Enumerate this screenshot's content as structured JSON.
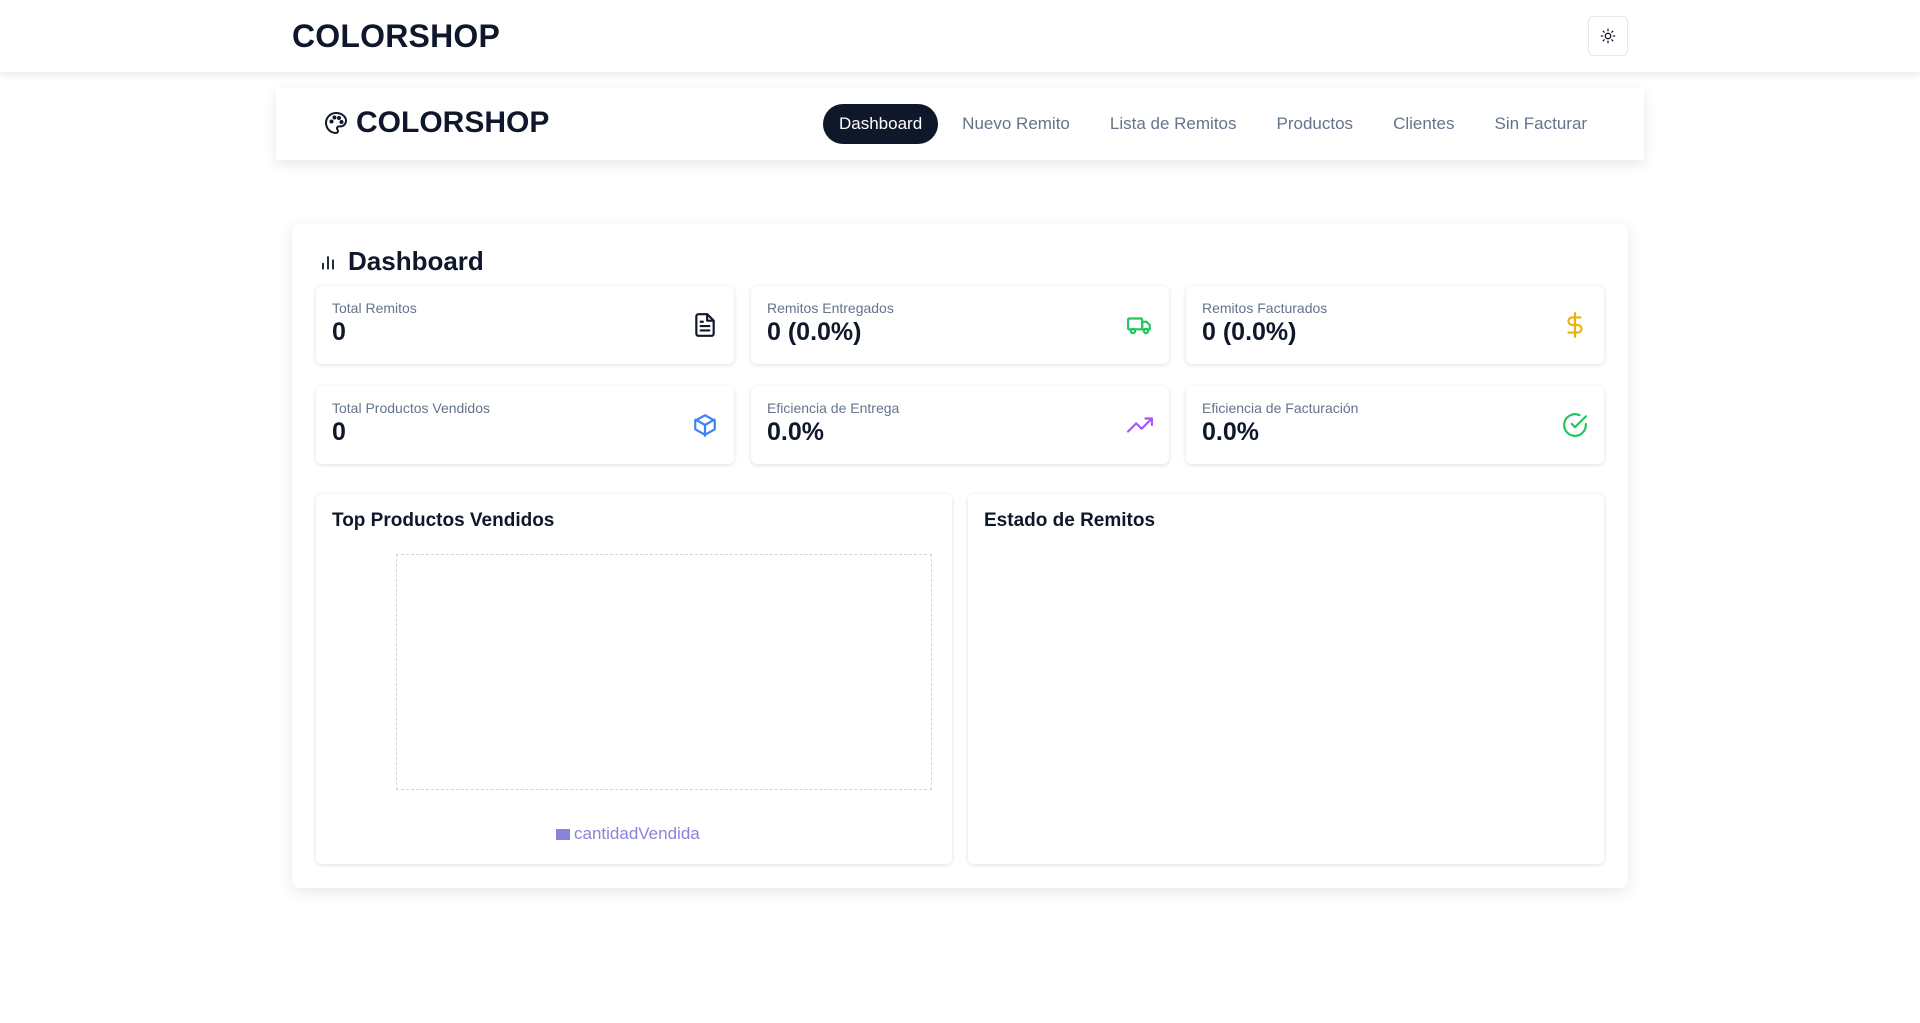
{
  "header": {
    "brand": "COLORSHOP",
    "theme_toggle_icon": "sun-icon"
  },
  "nav": {
    "brand": "COLORSHOP",
    "brand_icon": "palette-icon",
    "links": [
      {
        "label": "Dashboard",
        "active": true
      },
      {
        "label": "Nuevo Remito",
        "active": false
      },
      {
        "label": "Lista de Remitos",
        "active": false
      },
      {
        "label": "Productos",
        "active": false
      },
      {
        "label": "Clientes",
        "active": false
      },
      {
        "label": "Sin Facturar",
        "active": false
      }
    ]
  },
  "dashboard": {
    "title": "Dashboard",
    "title_icon": "bar-chart-icon",
    "stats": [
      {
        "label": "Total Remitos",
        "value": "0",
        "icon": "file-text-icon",
        "color": "#0f172a"
      },
      {
        "label": "Remitos Entregados",
        "value": "0 (0.0%)",
        "icon": "truck-icon",
        "color": "#22c55e"
      },
      {
        "label": "Remitos Facturados",
        "value": "0 (0.0%)",
        "icon": "dollar-icon",
        "color": "#eab308"
      },
      {
        "label": "Total Productos Vendidos",
        "value": "0",
        "icon": "package-icon",
        "color": "#3b82f6"
      },
      {
        "label": "Eficiencia de Entrega",
        "value": "0.0%",
        "icon": "trending-up-icon",
        "color": "#a855f7"
      },
      {
        "label": "Eficiencia de Facturación",
        "value": "0.0%",
        "icon": "check-circle-icon",
        "color": "#22c55e"
      }
    ],
    "top_products": {
      "title": "Top Productos Vendidos",
      "legend": "cantidadVendida",
      "legend_color": "#8884d8"
    },
    "status": {
      "title": "Estado de Remitos"
    }
  },
  "chart_data": {
    "type": "bar",
    "categories": [],
    "series": [
      {
        "name": "cantidadVendida",
        "values": []
      }
    ],
    "title": "Top Productos Vendidos"
  }
}
